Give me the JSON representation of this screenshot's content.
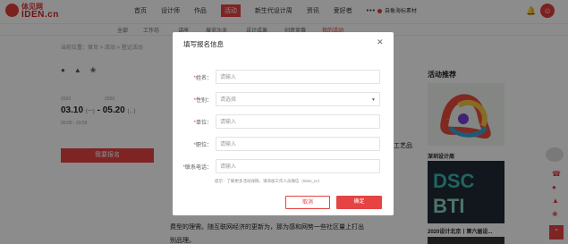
{
  "header": {
    "logo_cn": "体见网",
    "logo_en": "IDEN.cn",
    "nav": [
      "首页",
      "设计师",
      "作品",
      "活动",
      "新生代设计周",
      "资讯",
      "爱好者",
      "•••"
    ],
    "active_nav_index": 3,
    "hot_label": "自象海标素材"
  },
  "subnav": {
    "items": [
      "全部",
      "工作坊",
      "讲座",
      "展览沙龙",
      "设计成果",
      "创意竞赛",
      "我的活动"
    ],
    "selected_index": 6
  },
  "breadcrumb": "当前位置：首页 > 活动 > 登记活动",
  "event": {
    "start_year": "2020",
    "end_year": "2020",
    "start_date": "03.10",
    "start_weekday": "(一)",
    "end_date": "05.20",
    "end_weekday": "(...)",
    "time": "00:00 - 23:59",
    "register_label": "我要报名"
  },
  "article": {
    "line1": "工艺品",
    "line2": "费型的理需。随互联网经济的更新为，那为感和网势一些社区量上打出",
    "line3": "别品理。"
  },
  "recommend": {
    "title": "活动推荐",
    "cap1": "深圳设计周",
    "cap2": "2020设计北京丨第六届设..."
  },
  "modal": {
    "title": "填写报名信息",
    "fields": [
      {
        "label": "姓名：",
        "required": true,
        "placeholder": "请输入",
        "type": "input"
      },
      {
        "label": "性别：",
        "required": true,
        "placeholder": "请选择",
        "type": "select"
      },
      {
        "label": "单位：",
        "required": true,
        "placeholder": "请输入",
        "type": "input"
      },
      {
        "label": "职位：",
        "required": true,
        "placeholder": "请输入",
        "type": "input"
      },
      {
        "label": "联系电话：",
        "required": true,
        "placeholder": "请输入",
        "type": "input"
      }
    ],
    "hint": "提示：了解更多活动详情，请添加工作人员微信（IDen_cn）",
    "cancel_label": "取消",
    "confirm_label": "确定"
  },
  "colors": {
    "accent": "#e64343",
    "overlay": "rgba(0,0,0,0.45)"
  }
}
